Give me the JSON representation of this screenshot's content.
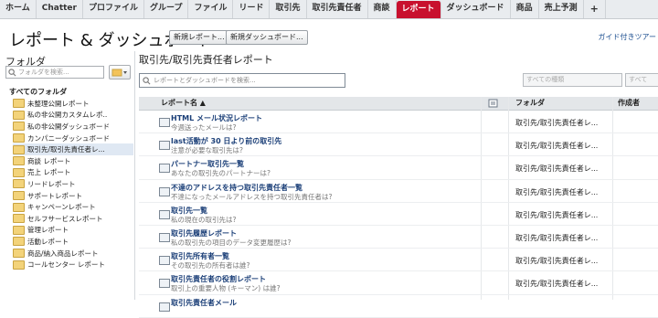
{
  "tabs": [
    {
      "label": "ホーム",
      "active": false
    },
    {
      "label": "Chatter",
      "active": false
    },
    {
      "label": "プロファイル",
      "active": false
    },
    {
      "label": "グループ",
      "active": false
    },
    {
      "label": "ファイル",
      "active": false
    },
    {
      "label": "リード",
      "active": false
    },
    {
      "label": "取引先",
      "active": false
    },
    {
      "label": "取引先責任者",
      "active": false
    },
    {
      "label": "商談",
      "active": false
    },
    {
      "label": "レポート",
      "active": true
    },
    {
      "label": "ダッシュボード",
      "active": false
    },
    {
      "label": "商品",
      "active": false
    },
    {
      "label": "売上予測",
      "active": false
    },
    {
      "label": "+",
      "active": false
    }
  ],
  "header": {
    "title": "レポート & ダッシュボード",
    "new_report_label": "新規レポート...",
    "new_dashboard_label": "新規ダッシュボード...",
    "help_link": "ガイド付きツアー"
  },
  "folders": {
    "title": "フォルダ",
    "search_placeholder": "フォルダを検索...",
    "all_label": "すべてのフォルダ",
    "items": [
      {
        "label": "未整理公開レポート"
      },
      {
        "label": "私の非公開カスタムレポ.."
      },
      {
        "label": "私の非公開ダッシュボード"
      },
      {
        "label": "カンパニーダッシュボード"
      },
      {
        "label": "取引先/取引先責任者レ...",
        "selected": true
      },
      {
        "label": "商談 レポート"
      },
      {
        "label": "売上 レポート"
      },
      {
        "label": "リードレポート"
      },
      {
        "label": "サポートレポート"
      },
      {
        "label": "キャンペーンレポート"
      },
      {
        "label": "セルフサービスレポート"
      },
      {
        "label": "管理レポート"
      },
      {
        "label": "活動レポート"
      },
      {
        "label": "商品/納入商品レポート"
      },
      {
        "label": "コールセンター レポート"
      }
    ]
  },
  "main": {
    "title": "取引先/取引先責任者レポート",
    "search_placeholder": "レポートとダッシュボードを検索...",
    "filter_placeholder": "すべての種類",
    "filter2_placeholder": "すべて",
    "columns": {
      "name": "レポート名 ▲",
      "folder": "フォルダ",
      "creator": "作成者"
    },
    "rows": [
      {
        "name": "HTML メール状況レポート",
        "desc": "今週送ったメールは?",
        "folder": "取引先/取引先責任者レ..."
      },
      {
        "name": "last活動が 30 日より前の取引先",
        "desc": "注意が必要な取引先は?",
        "folder": "取引先/取引先責任者レ..."
      },
      {
        "name": "パートナー取引先一覧",
        "desc": "あなたの取引先のパートナーは?",
        "folder": "取引先/取引先責任者レ..."
      },
      {
        "name": "不達のアドレスを持つ取引先責任者一覧",
        "desc": "不達になったメールアドレスを持つ取引先責任者は?",
        "folder": "取引先/取引先責任者レ..."
      },
      {
        "name": "取引先一覧",
        "desc": "私の現在の取引先は?",
        "folder": "取引先/取引先責任者レ..."
      },
      {
        "name": "取引先履歴レポート",
        "desc": "私の取引先の項目のデータ変更履歴は?",
        "folder": "取引先/取引先責任者レ..."
      },
      {
        "name": "取引先所有者一覧",
        "desc": "その取引先の所有者は誰?",
        "folder": "取引先/取引先責任者レ..."
      },
      {
        "name": "取引先責任者の役割レポート",
        "desc": "取引上の重要人物 (キーマン) は誰?",
        "folder": "取引先/取引先責任者レ..."
      },
      {
        "name": "取引先責任者メール",
        "desc": "",
        "folder": ""
      }
    ]
  }
}
